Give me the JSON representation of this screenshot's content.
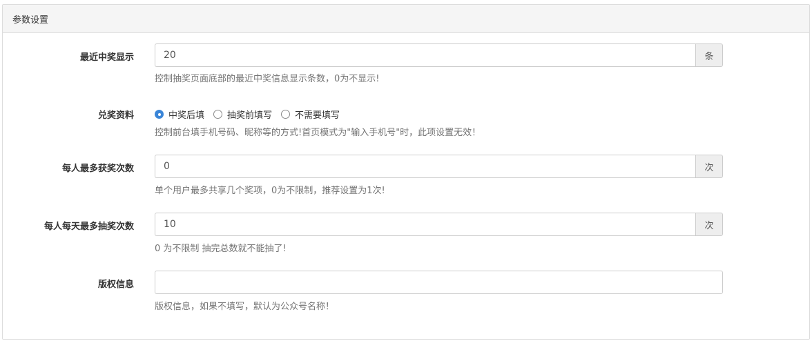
{
  "panel": {
    "title": "参数设置"
  },
  "fields": [
    {
      "label": "最近中奖显示",
      "value": "20",
      "unit": "条",
      "help": "控制抽奖页面底部的最近中奖信息显示条数，0为不显示!"
    },
    {
      "label": "兑奖资料",
      "options": [
        "中奖后填",
        "抽奖前填写",
        "不需要填写"
      ],
      "selected": "中奖后填",
      "help": "控制前台填手机号码、昵称等的方式!首页模式为\"输入手机号\"时，此项设置无效！"
    },
    {
      "label": "每人最多获奖次数",
      "value": "0",
      "unit": "次",
      "help": "单个用户最多共享几个奖项，0为不限制，推荐设置为1次!"
    },
    {
      "label": "每人每天最多抽奖次数",
      "value": "10",
      "unit": "次",
      "help": "0 为不限制 抽完总数就不能抽了!"
    },
    {
      "label": "版权信息",
      "value": "",
      "help": "版权信息，如果不填写，默认为公众号名称！"
    }
  ],
  "colors": {
    "accent": "#3b86d8",
    "help_text": "#737373",
    "addon_bg": "#eeeeee"
  }
}
